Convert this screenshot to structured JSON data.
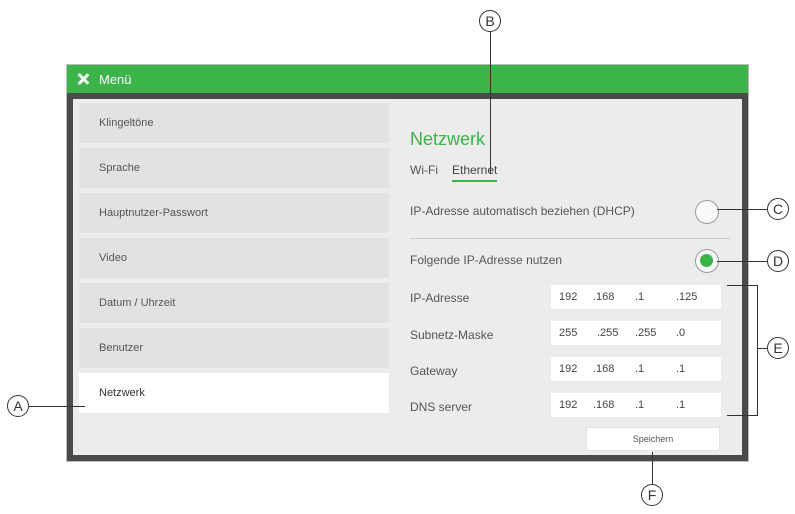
{
  "titlebar": {
    "title": "Menü"
  },
  "sidebar": {
    "items": [
      {
        "label": "Klingeltöne"
      },
      {
        "label": "Sprache"
      },
      {
        "label": "Hauptnutzer-Passwort"
      },
      {
        "label": "Video"
      },
      {
        "label": "Datum / Uhrzeit"
      },
      {
        "label": "Benutzer"
      },
      {
        "label": "Netzwerk"
      }
    ],
    "active_index": 6
  },
  "network": {
    "title": "Netzwerk",
    "tabs": [
      "Wi-Fi",
      "Ethernet"
    ],
    "active_tab": "Ethernet",
    "dhcp_label": "IP-Adresse automatisch beziehen (DHCP)",
    "dhcp_selected": false,
    "static_label": "Folgende IP-Adresse nutzen",
    "static_selected": true,
    "fields": [
      {
        "label": "IP-Adresse",
        "octets": [
          "192",
          ".168",
          ".1",
          ".125"
        ]
      },
      {
        "label": "Subnetz-Maske",
        "octets": [
          "255",
          ".255",
          ".255",
          ".0"
        ]
      },
      {
        "label": "Gateway",
        "octets": [
          "192",
          ".168",
          ".1",
          ".1"
        ]
      },
      {
        "label": "DNS server",
        "octets": [
          "192",
          ".168",
          ".1",
          ".1"
        ]
      }
    ],
    "save_label": "Speichern"
  },
  "callouts": [
    "A",
    "B",
    "C",
    "D",
    "E",
    "F"
  ],
  "colors": {
    "accent": "#3cb44a",
    "panel": "#ececec"
  }
}
